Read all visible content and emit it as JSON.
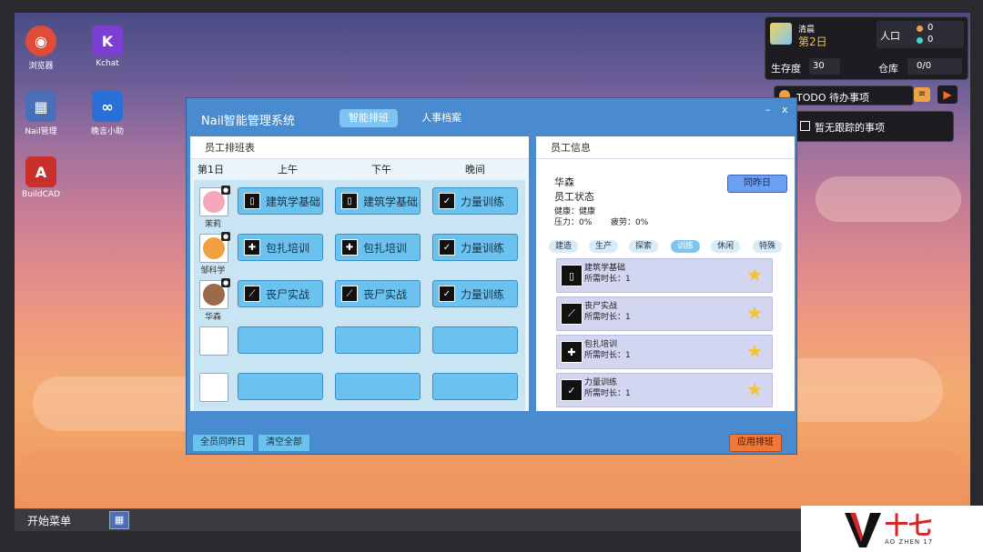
{
  "desktop": {
    "icons": [
      {
        "name": "browser-app",
        "label": "浏览器",
        "glyph": "◉",
        "color": "#e04b3a"
      },
      {
        "name": "kchat-app",
        "label": "Kchat",
        "glyph": "K",
        "color": "#7b3fd4"
      },
      {
        "name": "nail-manager-app",
        "label": "Nail管理",
        "glyph": "▦",
        "color": "#4a6fb8"
      },
      {
        "name": "ai-app",
        "label": "晚言小助",
        "glyph": "∞",
        "color": "#2a6fd6"
      },
      {
        "name": "buildcad-app",
        "label": "BuildCAD",
        "glyph": "A",
        "color": "#c9302c"
      }
    ]
  },
  "hud": {
    "time_label": "清晨",
    "day_label": "第2日",
    "population_label": "人口",
    "pop_values": [
      "0",
      "0"
    ],
    "survival_label": "生存度",
    "survival_value": "30",
    "storage_label": "仓库",
    "storage_value": "0/0",
    "todo_label": "TODO 待办事项",
    "todo_empty": "暂无跟踪的事项"
  },
  "window": {
    "title": "Nail智能管理系统",
    "tabs": [
      "智能排班",
      "人事档案"
    ],
    "minimize": "–",
    "close": "x",
    "schedule": {
      "header": "员工排班表",
      "day": "第1日",
      "columns": [
        "上午",
        "下午",
        "晚间"
      ],
      "rows": [
        {
          "name": "茉莉",
          "avatar": "#f3a7b9",
          "tasks": [
            "建筑学基础",
            "建筑学基础",
            "力量训练"
          ],
          "icons": [
            "▯",
            "▯",
            "✓"
          ]
        },
        {
          "name": "邹科学",
          "avatar": "#f0a040",
          "tasks": [
            "包扎培训",
            "包扎培训",
            "力量训练"
          ],
          "icons": [
            "✚",
            "✚",
            "✓"
          ]
        },
        {
          "name": "华森",
          "avatar": "#9b6a4a",
          "tasks": [
            "丧尸实战",
            "丧尸实战",
            "力量训练"
          ],
          "icons": [
            "⟋",
            "⟋",
            "✓"
          ]
        }
      ]
    },
    "info": {
      "header": "员工信息",
      "name": "华森",
      "status_label": "员工状态",
      "health_text": "健康：健康",
      "stress_text": "压力：0%",
      "fatigue_text": "疲劳：0%",
      "same_as_yesterday": "同昨日",
      "filters": [
        "建造",
        "生产",
        "探索",
        "训练",
        "休闲",
        "特殊"
      ],
      "active_filter": 3,
      "courses": [
        {
          "name": "建筑学基础",
          "duration": "所需时长：1",
          "icon": "▯"
        },
        {
          "name": "丧尸实战",
          "duration": "所需时长：1",
          "icon": "⟋"
        },
        {
          "name": "包扎培训",
          "duration": "所需时长：1",
          "icon": "✚"
        },
        {
          "name": "力量训练",
          "duration": "所需时长：1",
          "icon": "✓"
        }
      ]
    },
    "footer": {
      "all_same": "全员同昨日",
      "clear_all": "清空全部",
      "apply": "应用排班"
    }
  },
  "taskbar": {
    "start_menu": "开始菜单"
  },
  "watermark": {
    "cn": "十七",
    "en": "AO ZHEN 17"
  }
}
